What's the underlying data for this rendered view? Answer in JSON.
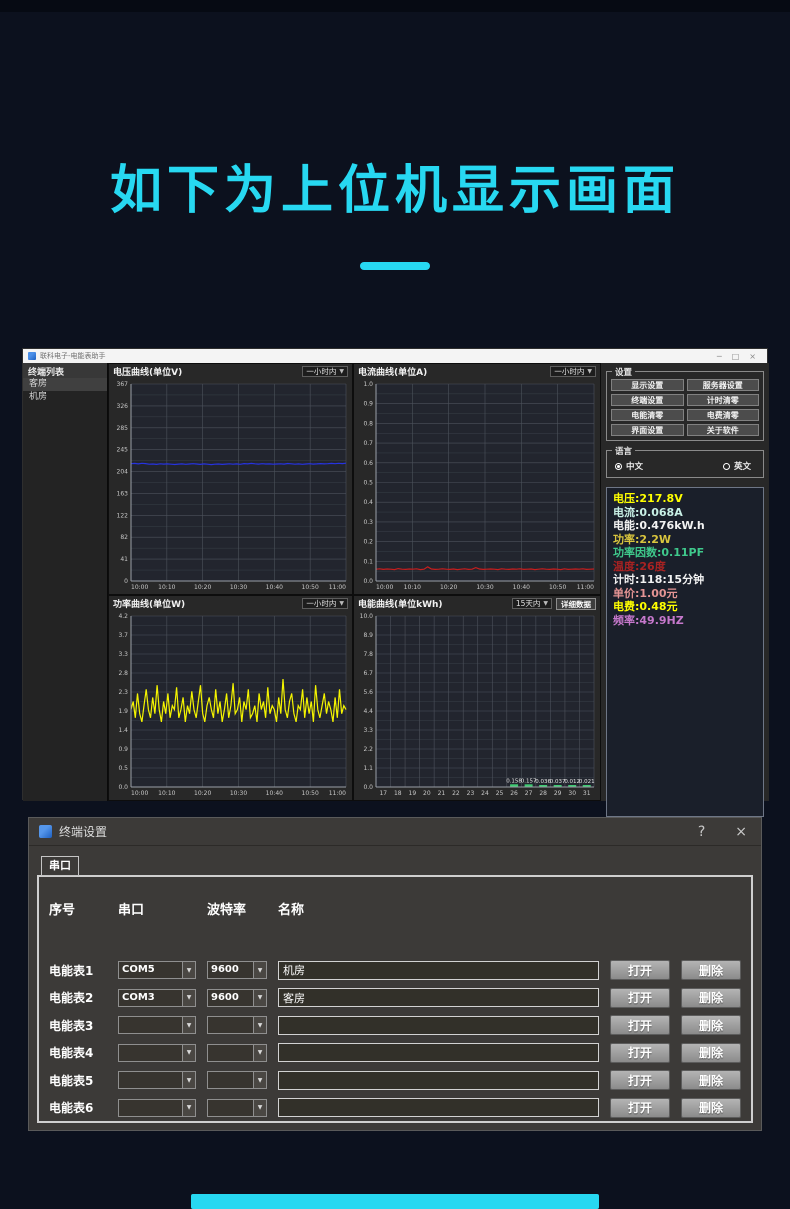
{
  "page": {
    "heading": "如下为上位机显示画面",
    "accent_color": "#27d8f1"
  },
  "main_window": {
    "title": "联科电子-电能表助手",
    "controls": {
      "minimize": "─",
      "maximize": "□",
      "close": "×"
    },
    "sidebar": {
      "title": "终端列表",
      "items": [
        {
          "label": "客房",
          "selected": true
        },
        {
          "label": "机房",
          "selected": false
        }
      ]
    },
    "settings_group": {
      "title": "设置",
      "buttons": [
        "显示设置",
        "服务器设置",
        "终端设置",
        "计时清零",
        "电能清零",
        "电费清零",
        "界面设置",
        "关于软件"
      ]
    },
    "language_group": {
      "title": "语言",
      "options": [
        {
          "label": "中文",
          "selected": true
        },
        {
          "label": "英文",
          "selected": false
        }
      ]
    },
    "readings": [
      {
        "label": "电压",
        "value": "217.8V",
        "color": "#ffff00"
      },
      {
        "label": "电流",
        "value": "0.068A",
        "color": "#c8f0e6"
      },
      {
        "label": "电能",
        "value": "0.476kW.h",
        "color": "#f2f2f2"
      },
      {
        "label": "功率",
        "value": "2.2W",
        "color": "#d9c53e"
      },
      {
        "label": "功率因数",
        "value": "0.11PF",
        "color": "#3fc98c"
      },
      {
        "label": "温度",
        "value": "26度",
        "color": "#a82222"
      },
      {
        "label": "计时",
        "value": "118:15分钟",
        "color": "#f2f2f2"
      },
      {
        "label": "单价",
        "value": "1.00元",
        "color": "#e49494"
      },
      {
        "label": "电费",
        "value": "0.48元",
        "color": "#ffff00"
      },
      {
        "label": "频率",
        "value": "49.9HZ",
        "color": "#c678cc"
      }
    ]
  },
  "chart_data": [
    {
      "type": "line",
      "title": "电压曲线(单位V)",
      "range_selector": "一小时内",
      "line_color": "#2633e0",
      "ylim": [
        0,
        367
      ],
      "yticklabels": [
        "0",
        "41",
        "82",
        "122",
        "163",
        "204",
        "245",
        "285",
        "326",
        "367"
      ],
      "xticklabels": [
        "10:00",
        "10:10",
        "10:20",
        "10:30",
        "10:40",
        "10:50",
        "11:00"
      ],
      "values": [
        218.5,
        219.0,
        218.2,
        219.3,
        218.8,
        217.6,
        218.0,
        217.3,
        218.4,
        217.8,
        218.1,
        217.5,
        217.0,
        217.8,
        218.2,
        217.4,
        218.0,
        218.6,
        217.9,
        217.3,
        218.1,
        217.6,
        216.9,
        217.5,
        218.0,
        217.2,
        217.8,
        218.3,
        217.6,
        218.1,
        217.4,
        218.7,
        218.2,
        219.0,
        218.4,
        217.8,
        218.5,
        217.9,
        218.2,
        217.5,
        218.0,
        218.4,
        217.7,
        218.9,
        218.3,
        217.6,
        218.1,
        217.4,
        217.9,
        218.5,
        217.8,
        218.2,
        218.8,
        218.1,
        218.5,
        219.0,
        218.6,
        219.2,
        218.8,
        219.4
      ]
    },
    {
      "type": "line",
      "title": "电流曲线(单位A)",
      "range_selector": "一小时内",
      "line_color": "#c81e1e",
      "ylim": [
        0,
        1.0
      ],
      "yticklabels": [
        "0.0",
        "0.1",
        "0.2",
        "0.3",
        "0.4",
        "0.5",
        "0.6",
        "0.7",
        "0.8",
        "0.9",
        "1.0"
      ],
      "xticklabels": [
        "10:00",
        "10:10",
        "10:20",
        "10:30",
        "10:40",
        "10:50",
        "11:00"
      ],
      "values": [
        0.06,
        0.062,
        0.059,
        0.061,
        0.06,
        0.058,
        0.063,
        0.06,
        0.059,
        0.061,
        0.06,
        0.062,
        0.058,
        0.06,
        0.072,
        0.061,
        0.059,
        0.06,
        0.062,
        0.06,
        0.059,
        0.061,
        0.058,
        0.06,
        0.062,
        0.059,
        0.06,
        0.068,
        0.061,
        0.059,
        0.06,
        0.061,
        0.06,
        0.058,
        0.062,
        0.06,
        0.059,
        0.061,
        0.06,
        0.062,
        0.059,
        0.06,
        0.061,
        0.058,
        0.06,
        0.062,
        0.06,
        0.059,
        0.061,
        0.06,
        0.058,
        0.062,
        0.059,
        0.06,
        0.061,
        0.06,
        0.062,
        0.059,
        0.06,
        0.061
      ]
    },
    {
      "type": "line",
      "title": "功率曲线(单位W)",
      "range_selector": "一小时内",
      "line_color": "#f5f500",
      "ylim": [
        0,
        4.2
      ],
      "yticklabels": [
        "0.0",
        "0.5",
        "0.9",
        "1.4",
        "1.9",
        "2.3",
        "2.8",
        "3.3",
        "3.7",
        "4.2"
      ],
      "xticklabels": [
        "10:00",
        "10:10",
        "10:20",
        "10:30",
        "10:40",
        "10:50",
        "11:00"
      ],
      "values": [
        1.9,
        2.1,
        1.7,
        2.3,
        1.8,
        1.6,
        2.0,
        2.4,
        1.9,
        1.7,
        2.2,
        1.8,
        2.5,
        1.9,
        1.6,
        2.1,
        1.8,
        2.3,
        1.7,
        2.0,
        1.9,
        2.45,
        1.7,
        1.9,
        2.2,
        1.6,
        2.0,
        1.8,
        2.35,
        1.9,
        1.7,
        2.1,
        2.5,
        1.8,
        1.6,
        2.0,
        2.2,
        1.9,
        1.7,
        2.4,
        1.8,
        2.1,
        1.6,
        1.9,
        2.3,
        1.7,
        2.0,
        2.55,
        1.8,
        1.9,
        2.2,
        1.6,
        2.1,
        1.9,
        2.4,
        1.7,
        1.8,
        2.0,
        1.6,
        2.3,
        1.9,
        2.1,
        1.7,
        2.45,
        1.8,
        2.0,
        1.9,
        1.6,
        2.2,
        1.8,
        2.65,
        1.9,
        1.7,
        2.1,
        2.3,
        1.8,
        1.6,
        2.0,
        1.9,
        2.4,
        1.7,
        2.2,
        1.8,
        2.1,
        1.6,
        2.5,
        1.9,
        1.7,
        2.0,
        2.3,
        1.8,
        2.1,
        1.9,
        1.6,
        2.2,
        1.7,
        2.4,
        1.8,
        2.0,
        1.9
      ]
    },
    {
      "type": "bar",
      "title": "电能曲线(单位kWh)",
      "range_selector": "15天内",
      "detail_button": "详细数据",
      "bar_color": "#3ecb72",
      "ylim": [
        0,
        10
      ],
      "yticklabels": [
        "0.0",
        "1.1",
        "2.2",
        "3.3",
        "4.4",
        "5.6",
        "6.7",
        "7.8",
        "8.9",
        "10.0"
      ],
      "categories": [
        "17",
        "18",
        "19",
        "20",
        "21",
        "22",
        "23",
        "24",
        "25",
        "26",
        "27",
        "28",
        "29",
        "30",
        "31"
      ],
      "values": [
        0,
        0,
        0,
        0,
        0,
        0,
        0,
        0,
        0,
        0.158,
        0.157,
        0.036,
        0.037,
        0.012,
        0.021
      ],
      "bar_labels": [
        "",
        "",
        "",
        "",
        "",
        "",
        "",
        "",
        "",
        "0.158",
        "0.157",
        "0.036",
        "0.037",
        "0.012",
        "0.021"
      ]
    }
  ],
  "dialog": {
    "title": "终端设置",
    "help": "?",
    "close": "×",
    "tab": "串口",
    "columns": [
      "序号",
      "串口",
      "波特率",
      "名称"
    ],
    "open_label": "打开",
    "delete_label": "删除",
    "rows": [
      {
        "label": "电能表1",
        "port": "COM5",
        "baud": "9600",
        "name": "机房"
      },
      {
        "label": "电能表2",
        "port": "COM3",
        "baud": "9600",
        "name": "客房"
      },
      {
        "label": "电能表3",
        "port": "",
        "baud": "",
        "name": ""
      },
      {
        "label": "电能表4",
        "port": "",
        "baud": "",
        "name": ""
      },
      {
        "label": "电能表5",
        "port": "",
        "baud": "",
        "name": ""
      },
      {
        "label": "电能表6",
        "port": "",
        "baud": "",
        "name": ""
      }
    ]
  }
}
